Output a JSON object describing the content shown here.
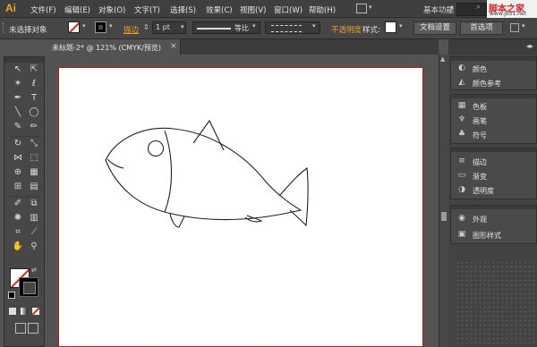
{
  "app": {
    "logo": "Ai"
  },
  "menu": [
    "文件(F)",
    "编辑(E)",
    "对象(O)",
    "文字(T)",
    "选择(S)",
    "效果(C)",
    "视图(V)",
    "窗口(W)",
    "帮助(H)"
  ],
  "menu_right": {
    "layout_icon": "layout-icon",
    "workspace": "基本功能",
    "search_icon": "search-icon"
  },
  "watermark": {
    "main": "脚本之家",
    "url": "www.jb51.net"
  },
  "control_bar": {
    "selection": "未选择对象",
    "stroke_label": "描边",
    "stroke_weight": "1 pt",
    "profile": "等比",
    "opacity_label": "不透明度",
    "style_label": "样式:",
    "doc_setup": "文档设置",
    "preferences": "首选项"
  },
  "document": {
    "tab_label": "未标题-2* @ 121% (CMYK/预览)",
    "close": "×"
  },
  "panels": [
    {
      "items": [
        {
          "icon": "color-icon",
          "label": "颜色"
        },
        {
          "icon": "color-guide-icon",
          "label": "颜色参考"
        }
      ]
    },
    {
      "items": [
        {
          "icon": "swatches-icon",
          "label": "色板"
        },
        {
          "icon": "brushes-icon",
          "label": "画笔"
        },
        {
          "icon": "symbols-icon",
          "label": "符号"
        }
      ]
    },
    {
      "items": [
        {
          "icon": "stroke-icon",
          "label": "描边"
        },
        {
          "icon": "gradient-icon",
          "label": "渐变"
        },
        {
          "icon": "transparency-icon",
          "label": "透明度"
        }
      ]
    },
    {
      "items": [
        {
          "icon": "appearance-icon",
          "label": "外观"
        },
        {
          "icon": "graphic-styles-icon",
          "label": "图形样式"
        }
      ]
    }
  ],
  "colors": {
    "accent": "#f39c2a",
    "artboard_border": "#b91c1c",
    "fill_none_slash": "#e02020"
  }
}
